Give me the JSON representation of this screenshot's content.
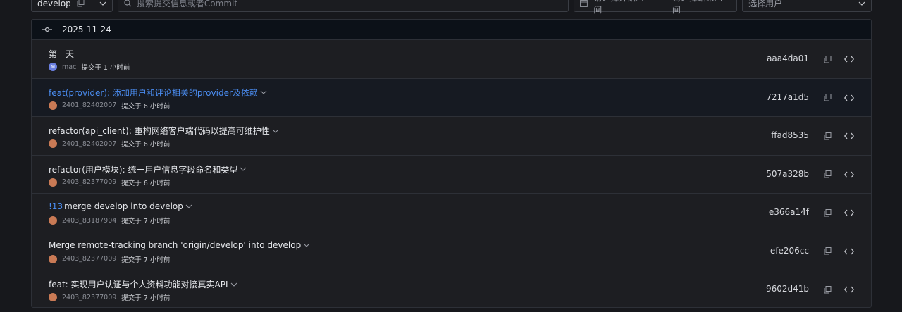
{
  "toolbar": {
    "branch": "develop",
    "search_placeholder": "搜索提交信息或者Commit",
    "date_start_placeholder": "请选择开始时间",
    "date_sep": "-",
    "date_end_placeholder": "请选择结束时间",
    "user_placeholder": "选择用户"
  },
  "group": {
    "date": "2025-11-24"
  },
  "commits": [
    {
      "prefix": "",
      "title": "第一天",
      "author": "mac",
      "avatar": "M",
      "time": "提交于 1 小时前",
      "hash": "aaa4da01"
    },
    {
      "prefix": "",
      "title": "feat(provider): 添加用户和评论相关的provider及依赖",
      "author": "2401_82402007",
      "avatar": "",
      "time": "提交于 6 小时前",
      "hash": "7217a1d5"
    },
    {
      "prefix": "",
      "title": "refactor(api_client): 重构网络客户端代码以提高可维护性",
      "author": "2401_82402007",
      "avatar": "",
      "time": "提交于 6 小时前",
      "hash": "ffad8535"
    },
    {
      "prefix": "",
      "title": "refactor(用户模块): 统一用户信息字段命名和类型",
      "author": "2403_82377009",
      "avatar": "",
      "time": "提交于 6 小时前",
      "hash": "507a328b"
    },
    {
      "prefix": "!13",
      "title": "merge develop into develop",
      "author": "2403_83187904",
      "avatar": "",
      "time": "提交于 7 小时前",
      "hash": "e366a14f"
    },
    {
      "prefix": "",
      "title": "Merge remote-tracking branch 'origin/develop' into develop",
      "author": "2403_82377009",
      "avatar": "",
      "time": "提交于 7 小时前",
      "hash": "efe206cc"
    },
    {
      "prefix": "",
      "title": "feat: 实现用户认证与个人资料功能对接真实API",
      "author": "2403_82377009",
      "avatar": "",
      "time": "提交于 7 小时前",
      "hash": "9602d41b"
    }
  ],
  "colors": {
    "accent": "#4a8cf0",
    "header_bg": "#0c1118",
    "row_bg": "#1d1e22",
    "border": "#2d3037"
  }
}
